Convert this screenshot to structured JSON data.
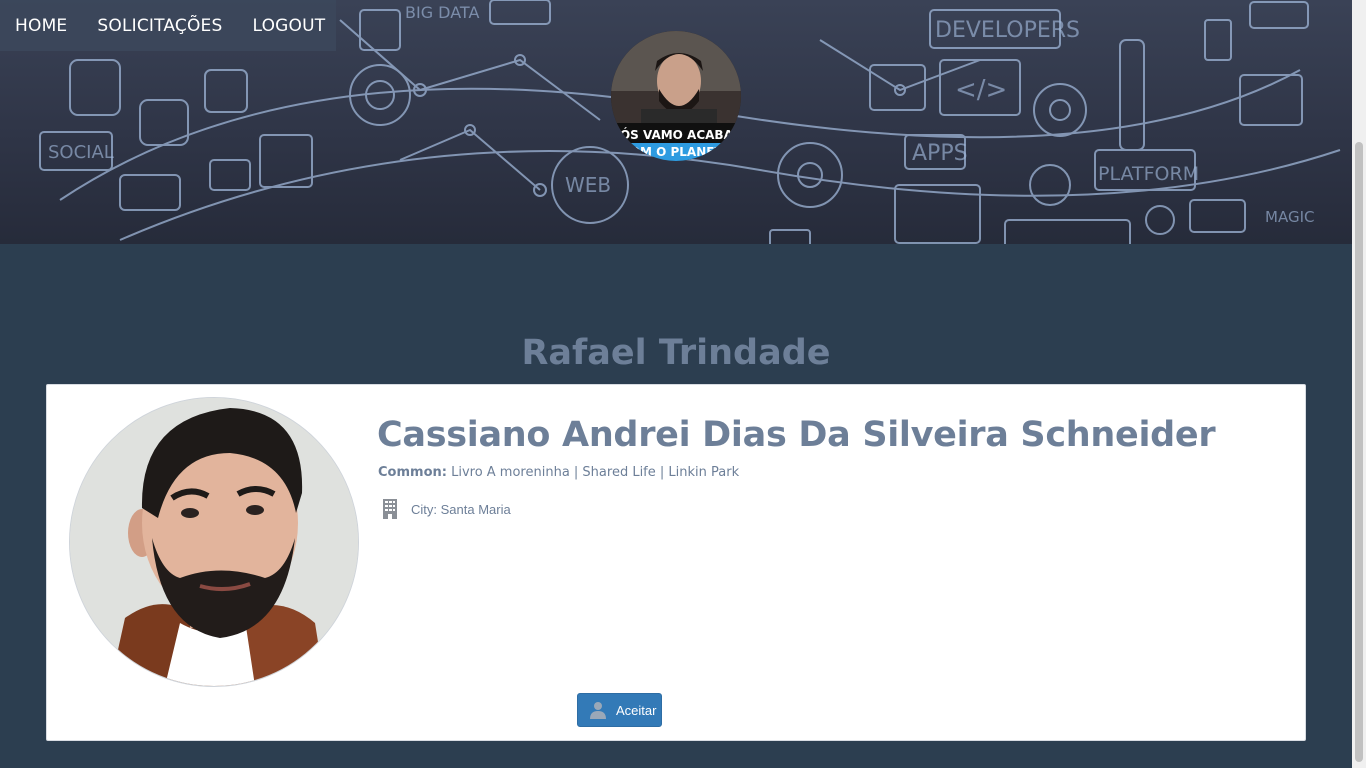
{
  "nav": {
    "items": [
      {
        "label": "HOME"
      },
      {
        "label": "SOLICITAÇÕES"
      },
      {
        "label": "LOGOUT"
      }
    ]
  },
  "banner": {
    "words": [
      "BIG DATA",
      "DEVELOPERS",
      "SOCIAL",
      "APPS",
      "PLATFORM",
      "WEB",
      "MAGIC",
      "</>"
    ],
    "avatar_caption_top": "NÓS VAMO ACABAR",
    "avatar_caption_bottom": "COM O PLANETA"
  },
  "profile_owner": {
    "name": "Rafael Trindade"
  },
  "request_card": {
    "name": "Cassiano Andrei Dias Da Silveira Schneider",
    "common_label": "Common:",
    "common_value": "Livro A moreninha | Shared Life | Linkin Park",
    "city_text": "City: Santa Maria",
    "accept_label": "Aceitar"
  },
  "colors": {
    "background": "#2c3e50",
    "accent_text": "#6d7f98",
    "button": "#337ab7"
  }
}
